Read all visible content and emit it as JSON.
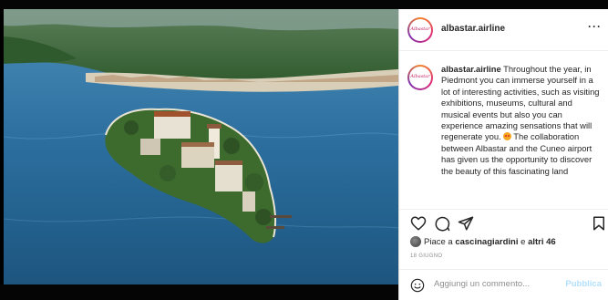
{
  "post": {
    "username": "albastar.airline",
    "avatar_text": "Albastar",
    "caption_username": "albastar.airline",
    "caption_before_emoji": "Throughout the year, in Piedmont you can immerse yourself in a lot of interesting activities, such as visiting exhibitions, museums, cultural and musical events but also you can experience amazing sensations that will regenerate you.",
    "caption_after_emoji": "The collaboration between Albastar and the Cuneo airport has given us the opportunity to discover the beauty of this fascinating land",
    "likes_prefix": "Piace a ",
    "likes_user": "cascinagiardini",
    "likes_middle": " e ",
    "likes_others": "altri 46",
    "date": "18 GIUGNO",
    "comment_placeholder": "Aggiungi un commento...",
    "publish_label": "Pubblica"
  },
  "icons": {
    "more": "more-options-icon",
    "like": "heart-icon",
    "comment": "comment-icon",
    "share": "send-icon",
    "save": "bookmark-icon",
    "emoji": "emoji-icon"
  },
  "colors": {
    "publish_disabled": "#b2dffc",
    "secondary_text": "#8e8e8e",
    "lake_blue": "#2a6f9e"
  }
}
